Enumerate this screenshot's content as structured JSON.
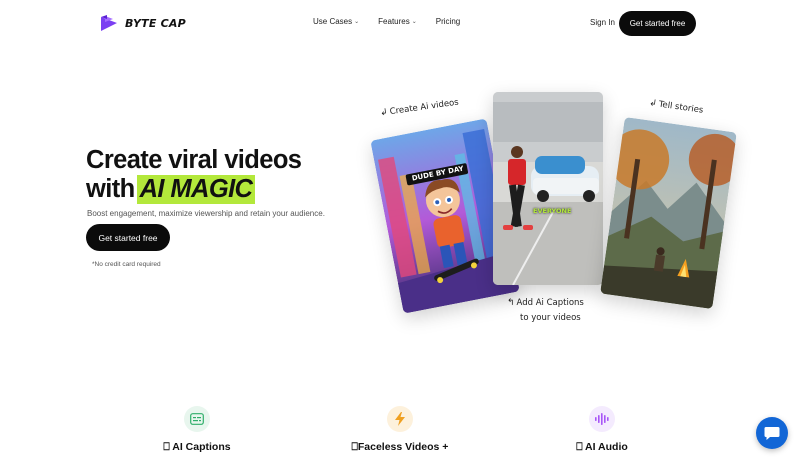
{
  "brand": {
    "name": "BYTE CAP",
    "logo_color": "#7b3ff2"
  },
  "nav": {
    "links": [
      {
        "label": "Use Cases",
        "has_caret": true
      },
      {
        "label": "Features",
        "has_caret": true
      },
      {
        "label": "Pricing",
        "has_caret": false
      }
    ],
    "sign_in": "Sign In",
    "cta": "Get started free"
  },
  "hero": {
    "title_line1": "Create viral videos",
    "title_with": "with",
    "title_highlight": "AI MAGIC",
    "subtitle": "Boost engagement, maximize viewership and retain your audience.",
    "cta": "Get started free",
    "note": "*No credit card required",
    "highlight_color": "#b3e83b"
  },
  "showcase": {
    "label_left": "Create Ai videos",
    "label_right": "Tell stories",
    "label_bottom_line1": "Add Ai Captions",
    "label_bottom_line2": "to your videos",
    "card_left_caption": "DUDE BY DAY",
    "card_mid_caption": "EVERYONE"
  },
  "features": [
    {
      "label": "AI Captions",
      "icon": "captions-icon",
      "color": "#2fae6a"
    },
    {
      "label": "Faceless Videos +",
      "icon": "lightning-icon",
      "color": "#f0a020"
    },
    {
      "label": "AI Audio",
      "icon": "audio-wave-icon",
      "color": "#a855f7"
    }
  ],
  "chat": {
    "icon": "chat-bubble-icon",
    "color": "#1266d6"
  }
}
